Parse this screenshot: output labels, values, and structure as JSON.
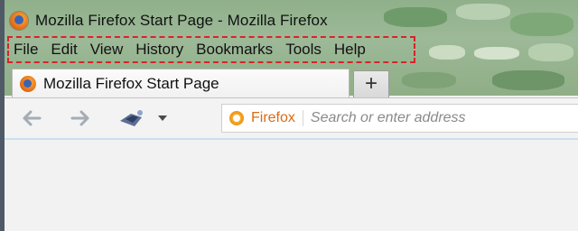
{
  "window": {
    "title": "Mozilla Firefox Start Page - Mozilla Firefox"
  },
  "menubar": {
    "items": [
      {
        "label": "File"
      },
      {
        "label": "Edit"
      },
      {
        "label": "View"
      },
      {
        "label": "History"
      },
      {
        "label": "Bookmarks"
      },
      {
        "label": "Tools"
      },
      {
        "label": "Help"
      }
    ],
    "highlight_color": "#d8232a"
  },
  "tabs": [
    {
      "label": "Mozilla Firefox Start Page",
      "icon": "firefox-icon",
      "active": true
    }
  ],
  "new_tab": {
    "label": "+"
  },
  "navbar": {
    "back_icon": "arrow-left-icon",
    "forward_icon": "arrow-right-icon",
    "identity_icon": "identity-icon",
    "dropdown_icon": "chevron-down-icon"
  },
  "urlbar": {
    "brand": "Firefox",
    "placeholder": "Search or enter address",
    "value": ""
  },
  "colors": {
    "brand_orange": "#d96b14",
    "aero_green": "#8fb08a"
  }
}
